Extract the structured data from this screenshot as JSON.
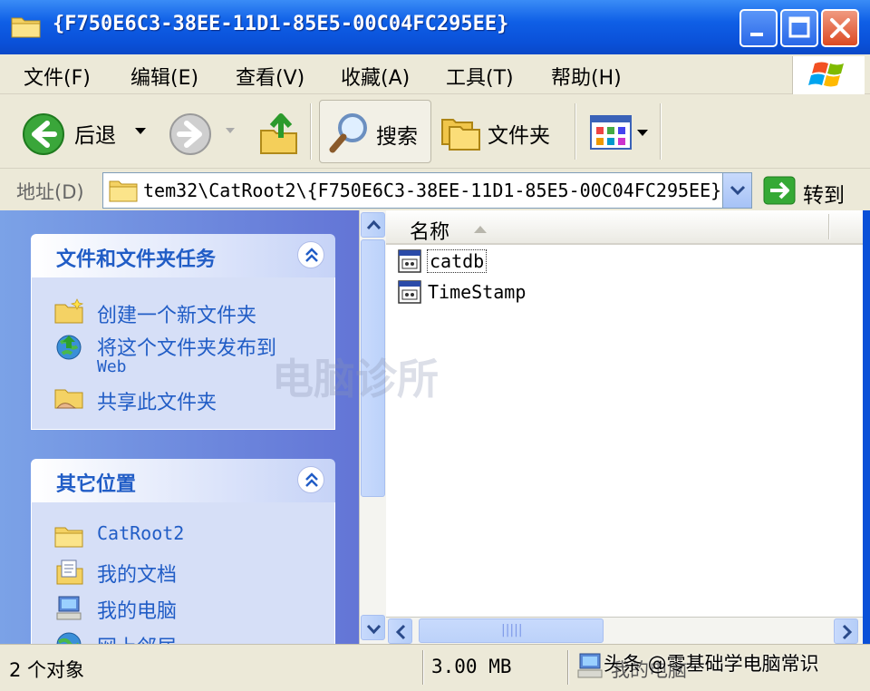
{
  "window": {
    "title": "{F750E6C3-38EE-11D1-85E5-00C04FC295EE}"
  },
  "menu": {
    "items": [
      "文件(F)",
      "编辑(E)",
      "查看(V)",
      "收藏(A)",
      "工具(T)",
      "帮助(H)"
    ]
  },
  "toolbar": {
    "back_label": "后退",
    "search_label": "搜索",
    "folders_label": "文件夹"
  },
  "address": {
    "label": "地址(D)",
    "value": "tem32\\CatRoot2\\{F750E6C3-38EE-11D1-85E5-00C04FC295EE}",
    "go_label": "转到"
  },
  "tasks_panel": {
    "title": "文件和文件夹任务",
    "links": [
      "创建一个新文件夹",
      "将这个文件夹发布到",
      "共享此文件夹"
    ],
    "web_suffix": "Web"
  },
  "places_panel": {
    "title": "其它位置",
    "links": [
      "CatRoot2",
      "我的文档",
      "我的电脑",
      "网上邻居"
    ]
  },
  "file_list": {
    "column_name": "名称",
    "files": [
      "catdb",
      "TimeStamp"
    ]
  },
  "status": {
    "count": "2 个对象",
    "size": "3.00 MB",
    "zone": "我的电脑"
  },
  "overlay": {
    "watermark": "电脑诊所",
    "brand": "头条 @零基础学电脑常识"
  },
  "colors": {
    "titlebar": "#0a50d8",
    "link": "#215dc6",
    "pane": "#6375d6"
  }
}
